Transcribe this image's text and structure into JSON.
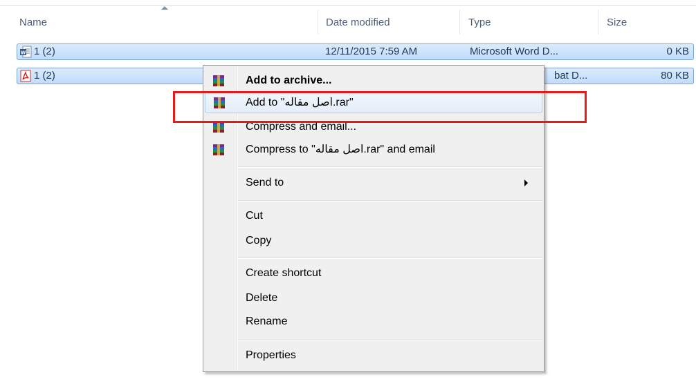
{
  "columns": {
    "name": "Name",
    "date_modified": "Date modified",
    "type": "Type",
    "size": "Size"
  },
  "files": [
    {
      "name": "1 (2)",
      "date_modified": "12/11/2015 7:59 AM",
      "type": "Microsoft Word D...",
      "size": "0 KB",
      "icon": "word-document-icon"
    },
    {
      "name": "1 (2)",
      "date_modified": "",
      "type": "bat D...",
      "size": "80 KB",
      "icon": "pdf-document-icon"
    }
  ],
  "context_menu": {
    "add_to_archive": "Add to archive...",
    "add_to_rar": "Add to \"اصل مقاله.rar\"",
    "compress_and_email": "Compress and email...",
    "compress_to_rar_email": "Compress to \"اصل مقاله.rar\" and email",
    "send_to": "Send to",
    "cut": "Cut",
    "copy": "Copy",
    "create_shortcut": "Create shortcut",
    "delete": "Delete",
    "rename": "Rename",
    "properties": "Properties"
  },
  "colors": {
    "selection": "#c1dcfc",
    "highlight_box": "#e31b1b"
  }
}
